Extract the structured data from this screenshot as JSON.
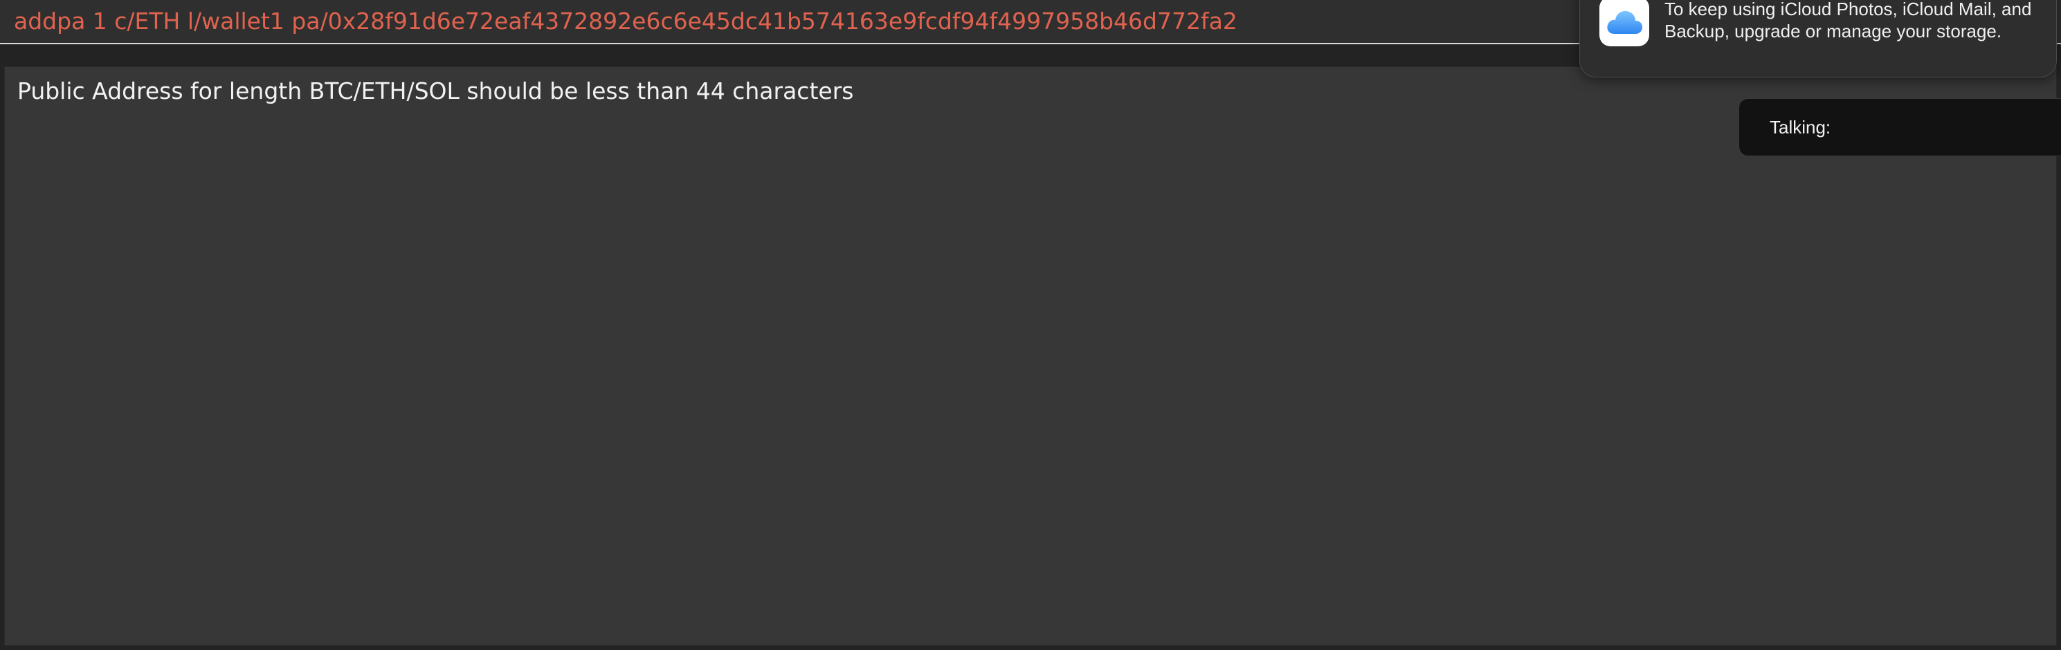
{
  "command": {
    "value": "addpa 1 c/ETH l/wallet1 pa/0x28f91d6e72eaf4372892e6c6e45dc41b574163e9fcdf94f4997958b46d772fa2"
  },
  "output": {
    "message": "Public Address for length BTC/ETH/SOL should be less than 44 characters"
  },
  "notification": {
    "app_icon": "icloud-icon",
    "message": "To keep using iCloud Photos, iCloud Mail, and Backup, upgrade or manage your storage."
  },
  "talking_panel": {
    "label": "Talking:"
  },
  "colors": {
    "command_text": "#e0634f",
    "output_background": "#373737",
    "app_background": "#232323",
    "notification_background": "#2e2e2e",
    "talking_background": "#121212"
  }
}
